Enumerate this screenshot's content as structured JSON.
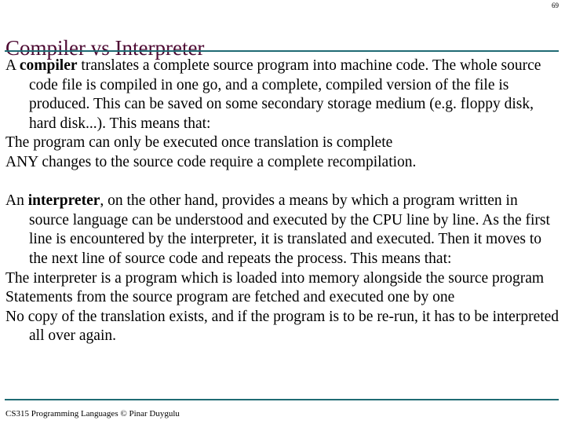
{
  "slide": {
    "page_number": "69",
    "title": "Compiler vs Interpreter",
    "accent_rule_color": "#1f6b74",
    "title_color": "#4d0a33",
    "background_color": "#ffffff",
    "text_color": "#000000"
  },
  "compiler_section": {
    "lead_bold": "compiler",
    "lead_prefix": "A ",
    "lead_rest": " translates a complete source program into machine code. The whole source code file is compiled in one go, and a complete, compiled version of the file is produced. This can be saved on some secondary storage medium (e.g. floppy disk, hard disk...). This means that:",
    "bullets": [
      "The program can only be executed once translation is complete",
      "ANY changes to the source code require a complete recompilation."
    ]
  },
  "interpreter_section": {
    "lead_prefix": "An ",
    "lead_bold": "interpreter",
    "lead_rest": ", on the other hand, provides a means by which a program written in source language can be understood and executed by the CPU line by line. As the first line is encountered by the interpreter, it is translated and executed. Then it moves to the next line of source code and repeats the process. This means that:",
    "bullets": [
      "The interpreter is a program which is loaded into memory alongside the source program",
      "Statements from the source program are fetched and executed one by one",
      "No copy of the translation exists, and if the program is to be re-run, it has to be interpreted all over again."
    ]
  },
  "footer": {
    "text": "CS315 Programming Languages © Pinar Duygulu"
  }
}
